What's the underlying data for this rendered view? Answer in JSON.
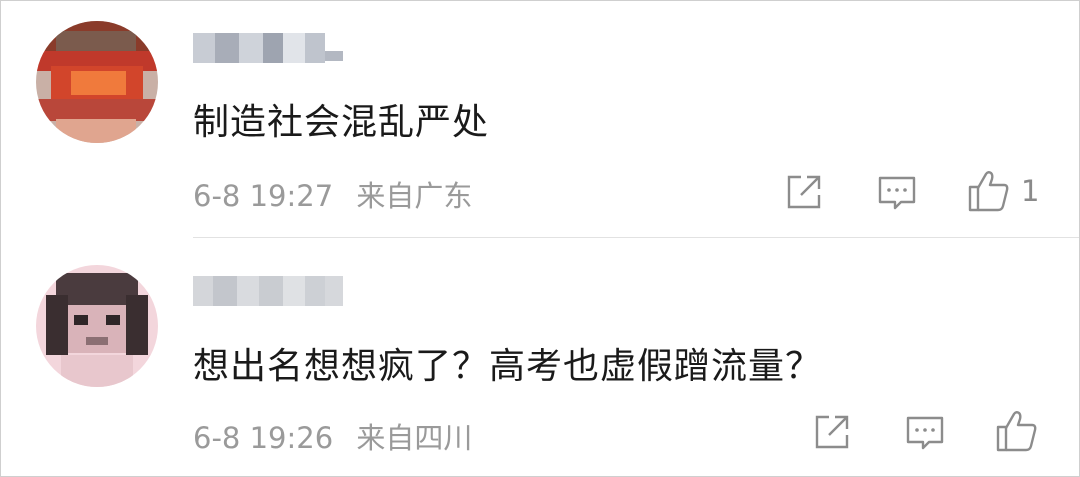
{
  "comments": [
    {
      "content": "制造社会混乱严处",
      "time": "6-8 19:27",
      "location": "来自广东",
      "like_count": "1",
      "icons": {
        "share": "share-icon",
        "reply": "reply-icon",
        "like": "thumbs-up-icon"
      },
      "avatar_palette": [
        "#8a3b2a",
        "#d2452b",
        "#f07a3c",
        "#c0392b",
        "#6b4a3a"
      ]
    },
    {
      "content": "想出名想想疯了？高考也虚假蹭流量？",
      "time": "6-8 19:26",
      "location": "来自四川",
      "like_count": "",
      "icons": {
        "share": "share-icon",
        "reply": "reply-icon",
        "like": "thumbs-up-icon"
      },
      "avatar_palette": [
        "#f3d6dc",
        "#4a3b3e",
        "#8b6f73",
        "#d9b3b9",
        "#2f2628"
      ]
    }
  ]
}
